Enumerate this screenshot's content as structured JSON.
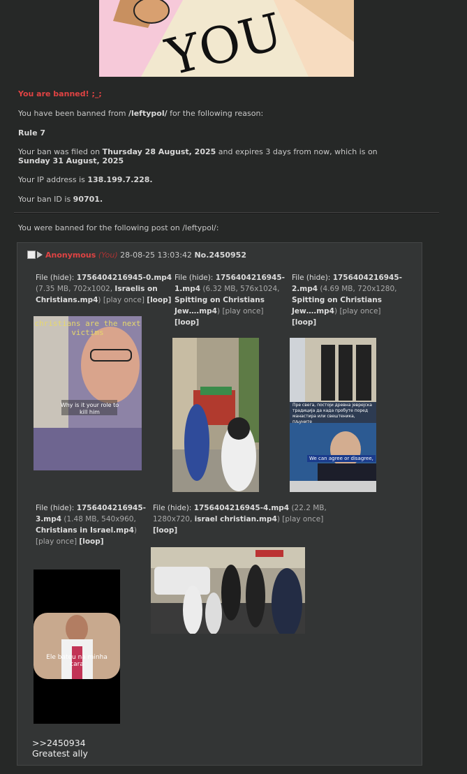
{
  "ban": {
    "title": "You are banned! ;_;",
    "board_sentence_pre": "You have been banned from ",
    "board": "/leftypol/",
    "board_sentence_post": " for the following reason:",
    "reason": "Rule 7",
    "filed_pre": "Your ban was filed on ",
    "filed_date": "Thursday 28 August, 2025",
    "filed_mid": " and expires 3 days from now, which is on ",
    "expire_date": "Sunday 31 August, 2025",
    "ip_pre": "Your IP address is ",
    "ip": "138.199.7.228.",
    "id_pre": "Your ban ID is ",
    "ban_id": "90701.",
    "post_intro": "You were banned for the following post on /leftypol/:",
    "image_text": "YOU"
  },
  "post": {
    "name": "Anonymous",
    "you": "(You)",
    "date": "28-08-25 13:03:42",
    "number": "No.2450952",
    "quote": ">>2450934",
    "message": "Greatest ally"
  },
  "files": [
    {
      "label": "File (hide):",
      "filename": "1756404216945-0.mp4",
      "meta": "(7.35 MB, 702x1002, ",
      "orig": "Israelis on Christians.mp4",
      "close": ")",
      "play": "[play once]",
      "loop": "[loop]",
      "caption_top": "christians are the next victims",
      "caption_mid": "Why is it your role to kill him"
    },
    {
      "label": "File (hide):",
      "filename": "1756404216945-1.mp4",
      "meta": "(6.32 MB, 576x1024, ",
      "orig": "Spitting on Christians Jew….mp4",
      "close": ")",
      "play": "[play once]",
      "loop": "[loop]"
    },
    {
      "label": "File (hide):",
      "filename": "1756404216945-2.mp4",
      "meta": "(4.69 MB, 720x1280, ",
      "orig": "Spitting on Christians Jew….mp4",
      "close": ")",
      "play": "[play once]",
      "loop": "[loop]",
      "caption_mid": "Пре свега, постоји древна јеврејска традиција да када пробуте поред манастира или свештеника, пљуните",
      "caption_low": "We can agree or disagree,"
    },
    {
      "label": "File (hide):",
      "filename": "1756404216945-3.mp4",
      "meta": "(1.48 MB, 540x960, ",
      "orig": "Christians in Israel.mp4",
      "close": ")",
      "play": "[play once]",
      "loop": "[loop]",
      "caption_mid": "Ele bateu na minha cara"
    },
    {
      "label": "File (hide):",
      "filename": "1756404216945-4.mp4",
      "meta": "(22.2 MB, 1280x720, ",
      "orig": "israel christian.mp4",
      "close": ")",
      "play": "[play once]",
      "loop": "[loop]"
    }
  ]
}
